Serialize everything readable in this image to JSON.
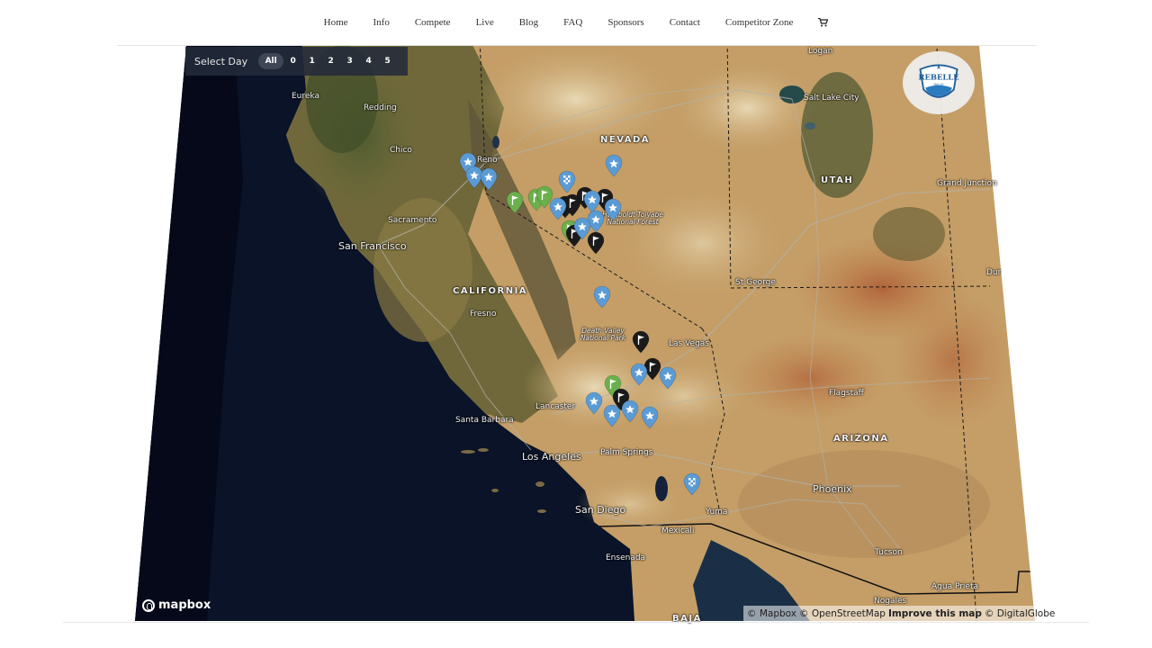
{
  "nav": {
    "items": [
      "Home",
      "Info",
      "Compete",
      "Live",
      "Blog",
      "FAQ",
      "Sponsors",
      "Contact",
      "Competitor Zone"
    ],
    "cart_icon": "shopping-cart-icon"
  },
  "day_selector": {
    "label": "Select Day",
    "options": [
      "All",
      "0",
      "1",
      "2",
      "3",
      "4",
      "5"
    ],
    "selected": "All"
  },
  "logo": {
    "text_line1": "REBELLE",
    "text_line2": "RALLY"
  },
  "map": {
    "provider_logo": "mapbox",
    "attribution": {
      "mapbox": "© Mapbox",
      "osm": "© OpenStreetMap",
      "improve": "Improve this map",
      "dg": "© DigitalGlobe"
    },
    "labels": {
      "states": [
        "NEVADA",
        "UTAH",
        "CALIFORNIA",
        "ARIZONA",
        "BAJA"
      ],
      "cities": [
        "Eureka",
        "Redding",
        "Chico",
        "Reno",
        "Sacramento",
        "San Francisco",
        "Fresno",
        "Logan",
        "Salt Lake City",
        "Grand Junction",
        "Dur",
        "St George",
        "Las Vegas",
        "Lancaster",
        "Santa Barbara",
        "Los Angeles",
        "Palm Springs",
        "San Diego",
        "Mexicali",
        "Yuma",
        "Ensenada",
        "Flagstaff",
        "Phoenix",
        "Tucson",
        "Agua Prieta",
        "Nogales"
      ],
      "parks": [
        "Humboldt-Toiyabe National Forest",
        "Death Valley National Park"
      ]
    },
    "marker_colors": {
      "start": "#1a1a1a",
      "star": "#5b9bd5",
      "checkered": "#5b9bd5",
      "green_flag": "#6ab04c"
    }
  }
}
